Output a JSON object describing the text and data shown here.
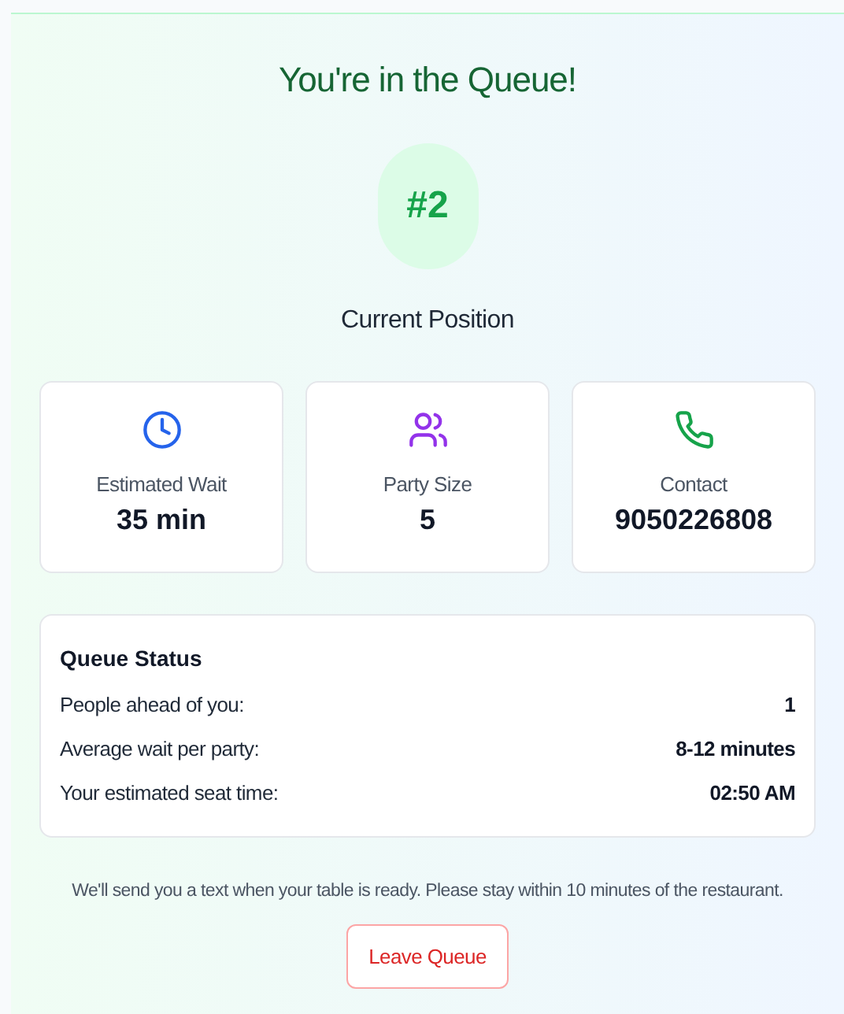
{
  "title": "You're in the Queue!",
  "position": {
    "number": "#2",
    "label": "Current Position"
  },
  "stats": [
    {
      "kind": "clock",
      "label": "Estimated Wait",
      "value": "35 min"
    },
    {
      "kind": "users",
      "label": "Party Size",
      "value": "5"
    },
    {
      "kind": "phone",
      "label": "Contact",
      "value": "9050226808"
    }
  ],
  "queue_status": {
    "title": "Queue Status",
    "rows": [
      {
        "label": "People ahead of you:",
        "value": "1"
      },
      {
        "label": "Average wait per party:",
        "value": "8-12 minutes"
      },
      {
        "label": "Your estimated seat time:",
        "value": "02:50 AM"
      }
    ]
  },
  "note": "We'll send you a text when your table is ready. Please stay within 10 minutes of the restaurant.",
  "buttons": [
    "Leave Queue"
  ]
}
